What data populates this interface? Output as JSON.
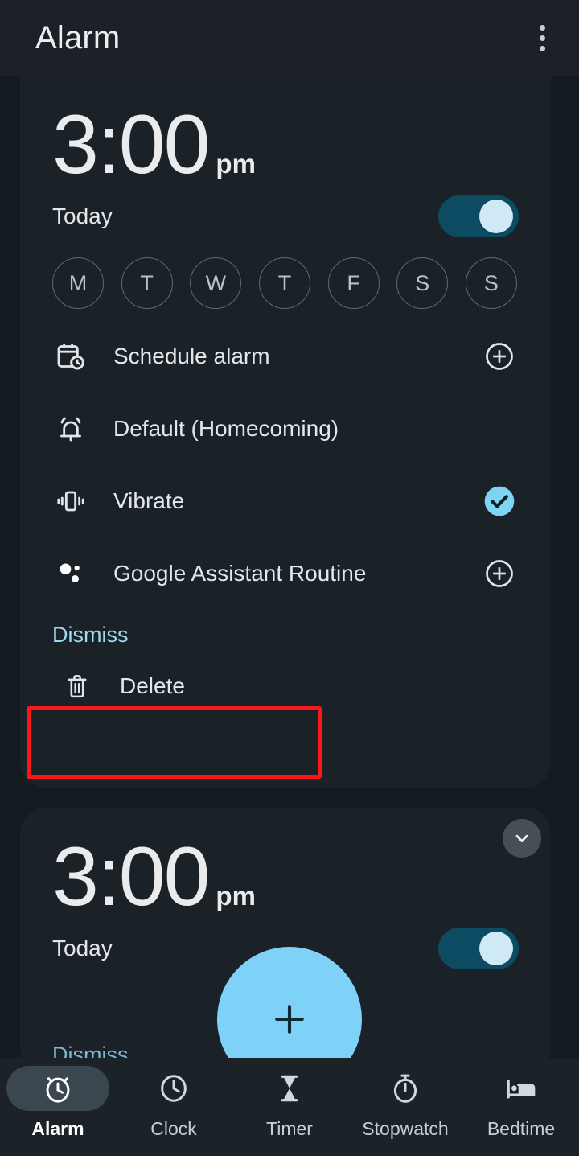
{
  "app_bar": {
    "title": "Alarm",
    "overflow_icon": "more-vert-icon"
  },
  "colors": {
    "page_background": "#131b20",
    "card_background": "#1a2228",
    "accent_light_blue": "#7ed2f7",
    "toggle_track_on": "#0d4b63",
    "toggle_thumb_on": "#cfe9f7",
    "link_blue": "#9fd8f0",
    "highlight_red": "#fb1717"
  },
  "alarms": [
    {
      "time": "3:00",
      "ampm": "pm",
      "day_label": "Today",
      "enabled": true,
      "expanded": true,
      "days": [
        {
          "letter": "M",
          "name": "monday",
          "selected": false
        },
        {
          "letter": "T",
          "name": "tuesday",
          "selected": false
        },
        {
          "letter": "W",
          "name": "wednesday",
          "selected": false
        },
        {
          "letter": "T",
          "name": "thursday",
          "selected": false
        },
        {
          "letter": "F",
          "name": "friday",
          "selected": false
        },
        {
          "letter": "S",
          "name": "saturday",
          "selected": false
        },
        {
          "letter": "S",
          "name": "sunday",
          "selected": false
        }
      ],
      "options": [
        {
          "label": "Schedule alarm",
          "icon": "calendar-clock-icon",
          "trailing": "plus-circle-outline-icon"
        },
        {
          "label": "Default (Homecoming)",
          "icon": "bell-ring-icon",
          "trailing": "none"
        },
        {
          "label": "Vibrate",
          "icon": "vibrate-icon",
          "trailing": "check-circle-filled-icon"
        },
        {
          "label": "Google Assistant Routine",
          "icon": "google-assistant-icon",
          "trailing": "plus-circle-outline-icon"
        }
      ],
      "dismiss_label": "Dismiss",
      "delete_label": "Delete",
      "delete_icon": "trash-icon"
    },
    {
      "time": "3:00",
      "ampm": "pm",
      "day_label": "Today",
      "enabled": true,
      "expanded": false,
      "expand_icon": "chevron-down-icon",
      "dismiss_label": "Dismiss"
    }
  ],
  "fab": {
    "icon": "plus-icon",
    "label": "Add alarm"
  },
  "bottom_nav": {
    "items": [
      {
        "label": "Alarm",
        "icon": "alarm-clock-icon",
        "active": true
      },
      {
        "label": "Clock",
        "icon": "clock-icon",
        "active": false
      },
      {
        "label": "Timer",
        "icon": "hourglass-icon",
        "active": false
      },
      {
        "label": "Stopwatch",
        "icon": "stopwatch-icon",
        "active": false
      },
      {
        "label": "Bedtime",
        "icon": "bed-icon",
        "active": false
      }
    ]
  }
}
